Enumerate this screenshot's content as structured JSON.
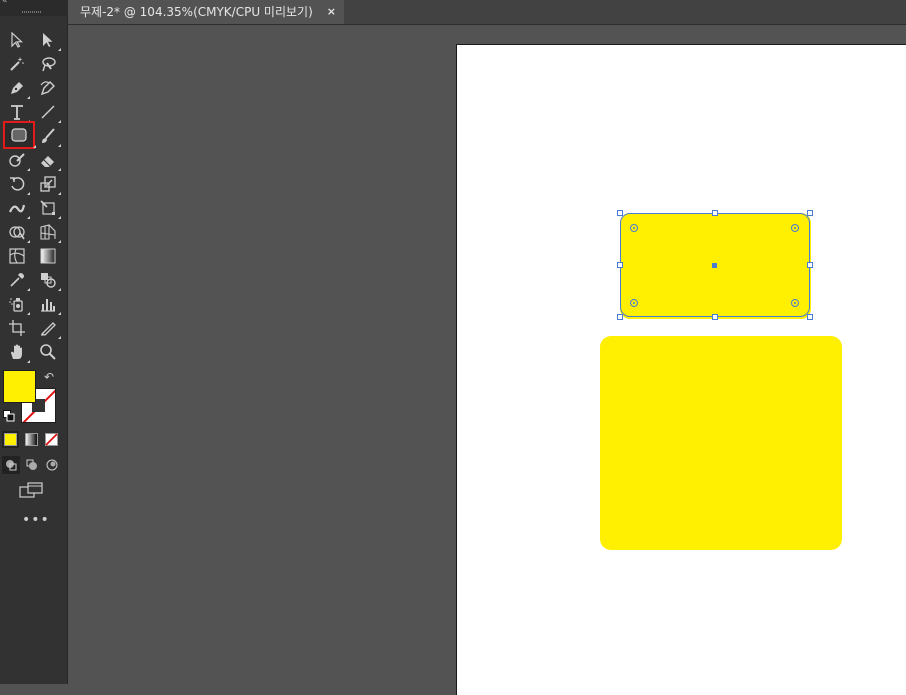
{
  "document_tab": {
    "title": "무제-2* @ 104.35%(CMYK/CPU  미리보기)",
    "close_glyph": "×"
  },
  "toolbar": {
    "collapse_glyph": "«",
    "tools": [
      {
        "name": "selection-tool",
        "icon": "arrow-icon"
      },
      {
        "name": "direct-selection-tool",
        "icon": "white-arrow-icon"
      },
      {
        "name": "magic-wand-tool",
        "icon": "magic-wand-icon"
      },
      {
        "name": "lasso-tool",
        "icon": "lasso-icon"
      },
      {
        "name": "pen-tool",
        "icon": "pen-icon"
      },
      {
        "name": "curvature-tool",
        "icon": "curvature-icon"
      },
      {
        "name": "type-tool",
        "icon": "type-icon"
      },
      {
        "name": "line-segment-tool",
        "icon": "line-icon"
      },
      {
        "name": "rectangle-tool",
        "icon": "rectangle-icon",
        "active": true
      },
      {
        "name": "paintbrush-tool",
        "icon": "brush-icon"
      },
      {
        "name": "shaper-tool",
        "icon": "shaper-icon"
      },
      {
        "name": "eraser-tool",
        "icon": "eraser-icon"
      },
      {
        "name": "rotate-tool",
        "icon": "rotate-icon"
      },
      {
        "name": "scale-tool",
        "icon": "scale-icon"
      },
      {
        "name": "width-tool",
        "icon": "width-icon"
      },
      {
        "name": "free-transform-tool",
        "icon": "free-transform-icon"
      },
      {
        "name": "shape-builder-tool",
        "icon": "shape-builder-icon"
      },
      {
        "name": "perspective-grid-tool",
        "icon": "perspective-icon"
      },
      {
        "name": "mesh-tool",
        "icon": "mesh-icon"
      },
      {
        "name": "gradient-tool",
        "icon": "gradient-icon"
      },
      {
        "name": "eyedropper-tool",
        "icon": "eyedropper-icon"
      },
      {
        "name": "blend-tool",
        "icon": "blend-icon"
      },
      {
        "name": "symbol-sprayer-tool",
        "icon": "symbol-sprayer-icon"
      },
      {
        "name": "column-graph-tool",
        "icon": "graph-icon"
      },
      {
        "name": "artboard-tool",
        "icon": "artboard-icon"
      },
      {
        "name": "slice-tool",
        "icon": "slice-icon"
      },
      {
        "name": "hand-tool",
        "icon": "hand-icon"
      },
      {
        "name": "zoom-tool",
        "icon": "zoom-icon"
      }
    ],
    "fill_color": "#ffef00",
    "swap_glyph": "↶",
    "more_glyph": "•••"
  },
  "colors": {
    "shape_fill": "#ffef00",
    "selection": "#4a7cd3",
    "active_tool_outline": "#e21b1b"
  }
}
